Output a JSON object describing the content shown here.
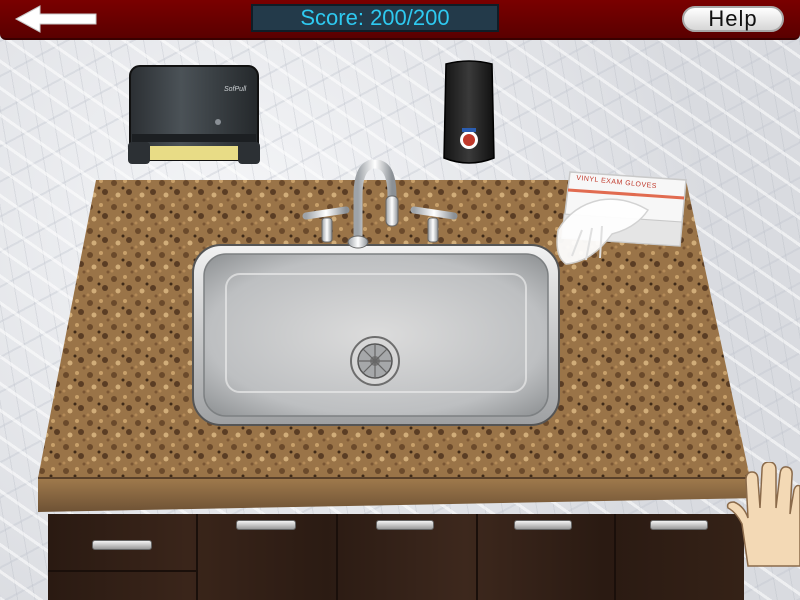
{
  "topbar": {
    "score_text": "Score: 200/200",
    "help_label": "Help"
  },
  "gloves_box": {
    "label": "VINYL EXAM GLOVES"
  },
  "towel_dispenser": {
    "label": "SofPull"
  },
  "colors": {
    "topbar": "#6e0000",
    "score_text": "#2ec9f0",
    "score_bg": "#233a4a",
    "granite": "#8a6a45",
    "cabinet": "#2f1e15"
  }
}
